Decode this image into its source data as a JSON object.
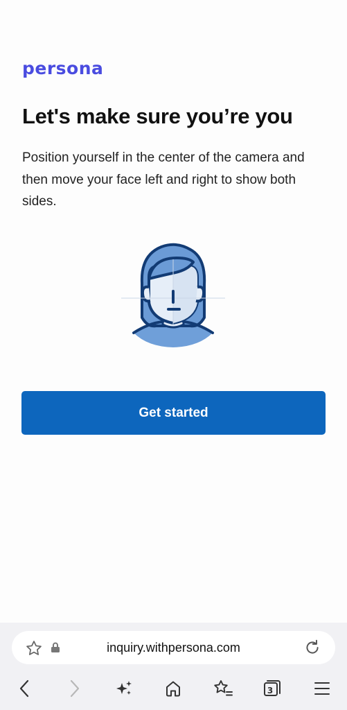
{
  "brand": {
    "logo_text": "persona",
    "color": "#4a4ce0"
  },
  "main": {
    "title": "Let's make sure you’re you",
    "description": "Position yourself in the center of the camera and then move your face left and right to show both sides.",
    "cta_label": "Get started",
    "cta_color": "#0d66bd",
    "illustration_icon": "face-scan-icon"
  },
  "browser": {
    "url": "inquiry.withpersona.com",
    "tab_count": "3",
    "icons": [
      "star-icon",
      "lock-icon",
      "reload-icon",
      "back-icon",
      "forward-icon",
      "sparkle-icon",
      "home-icon",
      "bookmarks-icon",
      "tabs-icon",
      "menu-icon"
    ]
  }
}
